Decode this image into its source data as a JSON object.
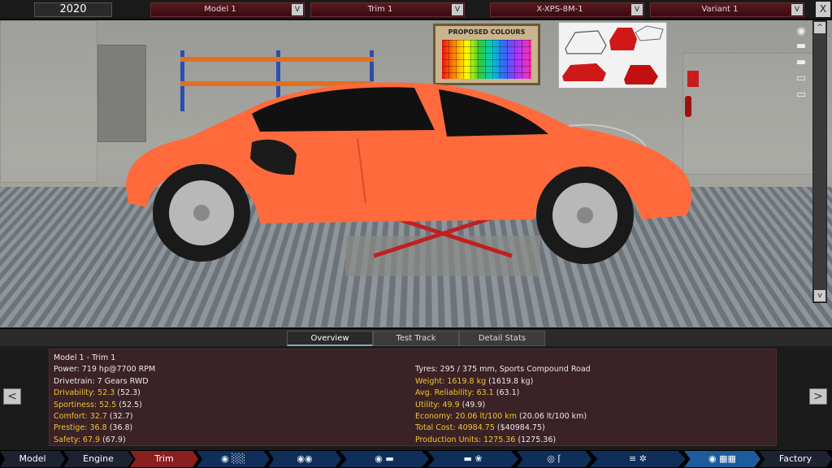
{
  "topbar": {
    "year": "2020",
    "dropdowns": {
      "model": "Model 1",
      "trim": "Trim 1",
      "engine": "X-XPS-8M-1",
      "variant": "Variant 1"
    },
    "dropdown_arrow": "V",
    "close_label": "X"
  },
  "scene": {
    "poster_title": "PROPOSED COLOURS",
    "car_color": "#ff6a3d",
    "scroll_up": "^",
    "scroll_down": "v"
  },
  "tabs": [
    "Overview",
    "Test Track",
    "Detail Stats"
  ],
  "stats": {
    "header": "Model 1 - Trim 1",
    "left": [
      {
        "text": "Power: 719 hp@7700 RPM",
        "highlight": false
      },
      {
        "text": "Drivetrain: 7 Gears RWD",
        "highlight": false
      },
      {
        "text": "Drivability: 52.3",
        "paren": " (52.3)",
        "highlight": true
      },
      {
        "text": "Sportiness: 52.5",
        "paren": " (52.5)",
        "highlight": true
      },
      {
        "text": "Comfort: 32.7",
        "paren": " (32.7)",
        "highlight": true
      },
      {
        "text": "Prestige: 36.8",
        "paren": " (36.8)",
        "highlight": true
      },
      {
        "text": "Safety: 67.9",
        "paren": " (67.9)",
        "highlight": true
      }
    ],
    "right": [
      {
        "text": "Tyres: 295 / 375 mm, Sports Compound Road",
        "highlight": false
      },
      {
        "text": "Weight: 1619.8 kg",
        "paren": " (1619.8 kg)",
        "highlight": true
      },
      {
        "text": "Avg. Reliability: 63.1",
        "paren": " (63.1)",
        "highlight": true
      },
      {
        "text": "Utility: 49.9",
        "paren": " (49.9)",
        "highlight": true
      },
      {
        "text": "Economy: 20.06 lt/100 km",
        "paren": " (20.06 lt/100 km)",
        "highlight": true
      },
      {
        "text": "Total Cost: 40984.75",
        "paren": " ($40984.75)",
        "highlight": true
      },
      {
        "text": "Production Units: 1275.36",
        "paren": " (1275.36)",
        "highlight": true
      }
    ]
  },
  "nav": {
    "prev": "<",
    "next": ">"
  },
  "bottom_nav": {
    "model": "Model",
    "engine": "Engine",
    "trim": "Trim",
    "factory": "Factory"
  },
  "colors": {
    "highlight": "#f2c52e",
    "accent_red": "#8a1f1f",
    "nav_blue": "#1d5b9c"
  }
}
